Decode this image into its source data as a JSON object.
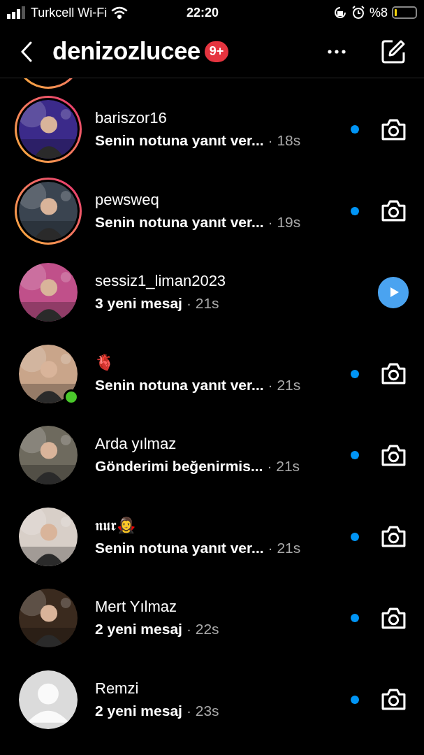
{
  "status_bar": {
    "carrier": "Turkcell Wi-Fi",
    "time": "22:20",
    "battery": "%8"
  },
  "header": {
    "title": "denizozlucee",
    "badge": "9+"
  },
  "threads": [
    {
      "name": "bariszor16",
      "preview": "Senin notuna yanıt ver...",
      "time": "· 18s",
      "story_ring": true,
      "online": false,
      "unread": true,
      "kind": "camera"
    },
    {
      "name": "pewsweq",
      "preview": "Senin notuna yanıt ver...",
      "time": "· 19s",
      "story_ring": true,
      "online": false,
      "unread": true,
      "kind": "camera"
    },
    {
      "name": "sessiz1_liman2023",
      "preview": "3 yeni mesaj",
      "time": "· 21s",
      "story_ring": false,
      "online": false,
      "unread": false,
      "kind": "play"
    },
    {
      "name": "🫀",
      "preview": "Senin notuna yanıt ver...",
      "time": "· 21s",
      "story_ring": false,
      "online": true,
      "unread": true,
      "kind": "camera"
    },
    {
      "name": "Arda yılmaz",
      "preview": "Gönderimi beğenirmis...",
      "time": "· 21s",
      "story_ring": false,
      "online": false,
      "unread": true,
      "kind": "camera"
    },
    {
      "name": "𝖓𝖚𝖗🧛‍♀️",
      "preview": "Senin notuna yanıt ver...",
      "time": "· 21s",
      "story_ring": false,
      "online": false,
      "unread": true,
      "kind": "camera"
    },
    {
      "name": "Mert Yılmaz",
      "preview": "2 yeni mesaj",
      "time": "· 22s",
      "story_ring": false,
      "online": false,
      "unread": true,
      "kind": "camera"
    },
    {
      "name": "Remzi",
      "preview": "2 yeni mesaj",
      "time": "· 23s",
      "story_ring": false,
      "online": false,
      "unread": true,
      "kind": "camera",
      "avatar": {
        "kind": "default"
      }
    }
  ]
}
